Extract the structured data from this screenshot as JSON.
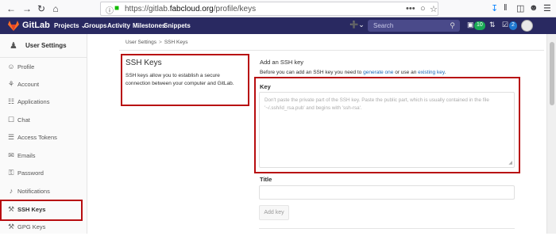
{
  "browser": {
    "url_prefix": "https://gitlab.",
    "url_domain": "fabcloud.org",
    "url_path": "/profile/keys",
    "url_more": "•••"
  },
  "header": {
    "brand": "GitLab",
    "nav": [
      "Projects ⌄",
      "Groups",
      "Activity",
      "Milestones",
      "Snippets"
    ],
    "search_placeholder": "Search",
    "todo_count": "10",
    "mr_count": "2"
  },
  "sidebar": {
    "title": "User Settings",
    "items": [
      {
        "label": "Profile",
        "icon": "☺"
      },
      {
        "label": "Account",
        "icon": "⚘"
      },
      {
        "label": "Applications",
        "icon": "☷"
      },
      {
        "label": "Chat",
        "icon": "☐"
      },
      {
        "label": "Access Tokens",
        "icon": "☰"
      },
      {
        "label": "Emails",
        "icon": "✉"
      },
      {
        "label": "Password",
        "icon": "⚿"
      },
      {
        "label": "Notifications",
        "icon": "♪"
      },
      {
        "label": "SSH Keys",
        "icon": "⚒"
      },
      {
        "label": "GPG Keys",
        "icon": "⚒"
      }
    ]
  },
  "breadcrumb": {
    "parent": "User Settings",
    "separator": ">",
    "current": "SSH Keys"
  },
  "info": {
    "title": "SSH Keys",
    "description": "SSH keys allow you to establish a secure connection between your computer and GitLab."
  },
  "form": {
    "heading": "Add an SSH key",
    "intro_before": "Before you can add an SSH key you need to ",
    "link_generate": "generate one",
    "intro_middle": " or use an ",
    "link_existing": "existing key",
    "intro_after": ".",
    "key_label": "Key",
    "key_placeholder": "Don't paste the private part of the SSH key. Paste the public part, which is usually contained in the file '~/.ssh/id_rsa.pub' and begins with 'ssh-rsa'.",
    "title_label": "Title",
    "title_value": "",
    "submit_label": "Add key"
  },
  "colors": {
    "header_bg": "#292961",
    "highlight_border": "#b80d10",
    "link": "#1b69b6"
  }
}
